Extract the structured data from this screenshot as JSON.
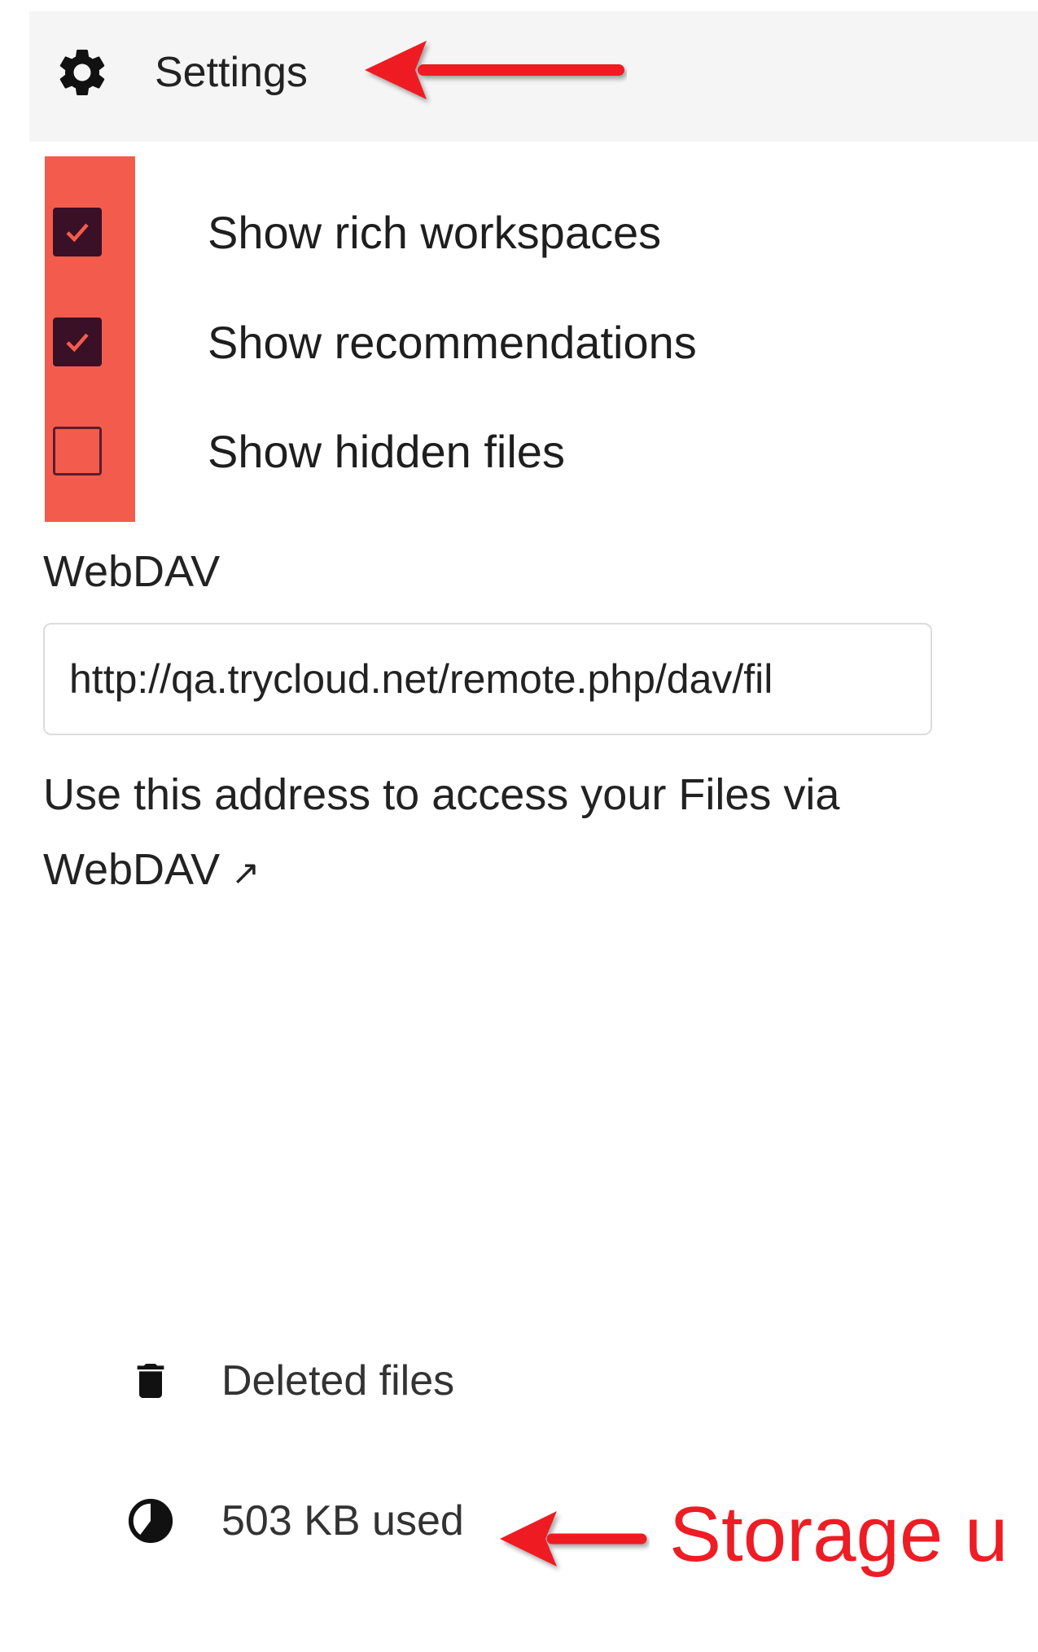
{
  "settings": {
    "label": "Settings",
    "icon": "gear-icon"
  },
  "options": [
    {
      "label": "Show rich workspaces",
      "checked": true
    },
    {
      "label": "Show recommendations",
      "checked": true
    },
    {
      "label": "Show hidden files",
      "checked": false
    }
  ],
  "webdav": {
    "title": "WebDAV",
    "url": "http://qa.trycloud.net/remote.php/dav/fil",
    "hint": "Use this address to access your Files via",
    "link_label": "WebDAV",
    "link_icon": "↗"
  },
  "nav": {
    "deleted_files": {
      "label": "Deleted files",
      "icon": "trash-icon"
    },
    "storage": {
      "label": "503 KB used",
      "icon": "pie-chart-icon"
    }
  },
  "annotations": {
    "storage": "Storage u",
    "arrow_color": "#ee1c24",
    "highlight_color": "#f35c4c"
  },
  "colors": {
    "checkbox_checked": "#3a1027",
    "header_bg": "#f5f5f5"
  }
}
